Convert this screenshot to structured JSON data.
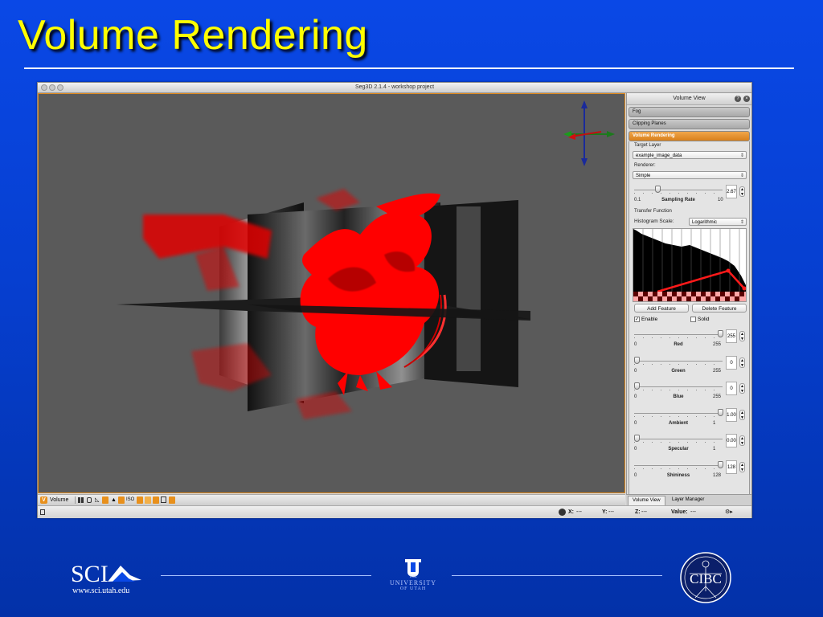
{
  "slide": {
    "title": "Volume Rendering"
  },
  "window": {
    "title": "Seg3D 2.1.4  - workshop project"
  },
  "viewer": {
    "view_label": "Volume",
    "toolbar_icons": [
      "grid-icon",
      "lock-icon",
      "ruler-icon",
      "picking-icon",
      "slices-icon",
      "iso-icon",
      "volume-render-icon",
      "bbox-icon",
      "light-icon",
      "copy-icon",
      "paste-icon"
    ],
    "iso_label": "ISO",
    "colors": {
      "volume": "#e30000",
      "background": "#5a5a5a",
      "border": "#e08a1e"
    }
  },
  "status": {
    "x_label": "X:",
    "x_value": "---",
    "y_label": "Y:",
    "y_value": "---",
    "z_label": "Z:",
    "z_value": "---",
    "value_label": "Value:",
    "value_value": "---"
  },
  "panel": {
    "title": "Volume View",
    "sections": {
      "fog": "Fog",
      "clipping": "Clipping Planes",
      "volume_rendering": "Volume Rendering"
    },
    "target_layer_label": "Target Layer",
    "target_layer_value": "example_image_data",
    "renderer_label": "Renderer:",
    "renderer_value": "Simple",
    "sampling": {
      "label": "Sampling Rate",
      "min": "0.1",
      "max": "10",
      "value": "2.67",
      "fraction": 0.25
    },
    "transfer_function_label": "Transfer Function",
    "histogram_scale_label": "Histogram Scale:",
    "histogram_scale_value": "Logarithmic",
    "add_feature": "Add Feature",
    "delete_feature": "Delete Feature",
    "enable_label": "Enable",
    "enable_checked": true,
    "solid_label": "Solid",
    "solid_checked": false,
    "sliders": [
      {
        "label": "Red",
        "min": "0",
        "max": "255",
        "value": "255",
        "fraction": 1.0
      },
      {
        "label": "Green",
        "min": "0",
        "max": "255",
        "value": "0",
        "fraction": 0.0
      },
      {
        "label": "Blue",
        "min": "0",
        "max": "255",
        "value": "0",
        "fraction": 0.0
      },
      {
        "label": "Ambient",
        "min": "0",
        "max": "1",
        "value": "1.00",
        "fraction": 1.0
      },
      {
        "label": "Specular",
        "min": "0",
        "max": "1",
        "value": "0.00",
        "fraction": 0.0
      },
      {
        "label": "Shininess",
        "min": "0",
        "max": "128",
        "value": "128",
        "fraction": 1.0
      }
    ],
    "tabs": {
      "volume_view": "Volume View",
      "layer_manager": "Layer Manager"
    }
  },
  "footer": {
    "sci_url": "www.sci.utah.edu",
    "sci_text": "SCI",
    "uu_line1": "THE",
    "uu_line2": "UNIVERSITY",
    "uu_line3": "OF UTAH",
    "cibc_text": "CIBC"
  }
}
